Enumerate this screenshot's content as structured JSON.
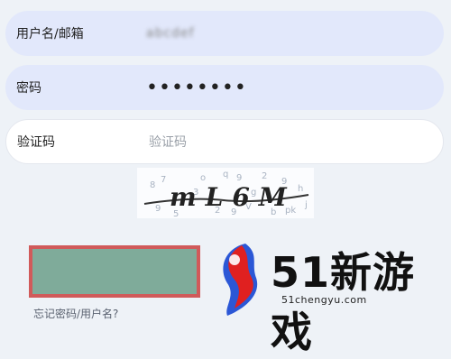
{
  "form": {
    "username": {
      "label": "用户名/邮箱",
      "value": "abcdef"
    },
    "password": {
      "label": "密码",
      "value": "••••••••"
    },
    "captcha": {
      "label": "验证码",
      "placeholder": "验证码",
      "image_text": "mL6M"
    },
    "forgot_link": "忘记密码/用户名?"
  },
  "watermark": {
    "title": "51新游戏",
    "url": "51chengyu.com"
  },
  "colors": {
    "filled_field": "#e2e8fb",
    "submit": "#7fab9a",
    "submit_border": "#d05a5a"
  }
}
